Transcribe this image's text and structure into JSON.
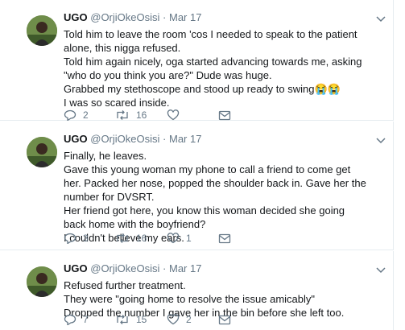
{
  "tweets": [
    {
      "name": "UGO",
      "handle": "@OrjiOkeOsisi",
      "dot": "·",
      "date": "Mar 17",
      "lines": [
        "Told him to leave the room 'cos I needed to speak to the patient alone, this nigga refused.",
        "Told him again nicely, oga started advancing towards me, asking \"who do you think you are?\" Dude was huge.",
        "Grabbed my stethoscope and stood up ready to swing",
        "I was so scared inside."
      ],
      "emoji": "😭😭",
      "replies": "2",
      "retweets": "16",
      "likes": ""
    },
    {
      "name": "UGO",
      "handle": "@OrjiOkeOsisi",
      "dot": "·",
      "date": "Mar 17",
      "lines": [
        "Finally, he leaves.",
        "Gave this young woman my phone to call a friend to come get her. Packed her nose, popped the shoulder back in. Gave her the number for DVSRT.",
        "Her friend got here, you know this woman decided she going back home with the boyfriend?",
        "I couldn't believe my ears."
      ],
      "replies": "3",
      "retweets": "16",
      "likes": "1"
    },
    {
      "name": "UGO",
      "handle": "@OrjiOkeOsisi",
      "dot": "·",
      "date": "Mar 17",
      "lines": [
        "Refused further treatment.",
        "They were \"going home to resolve the issue amicably\"",
        "Dropped the number I gave her in the bin before she left too."
      ],
      "replies": "7",
      "retweets": "15",
      "likes": "2"
    }
  ],
  "icons": {
    "reply": "reply-icon",
    "retweet": "retweet-icon",
    "like": "heart-icon",
    "dm": "envelope-icon",
    "caret": "chevron-down-icon"
  },
  "colors": {
    "text": "#14171a",
    "muted": "#657786",
    "border": "#e6ecf0"
  }
}
